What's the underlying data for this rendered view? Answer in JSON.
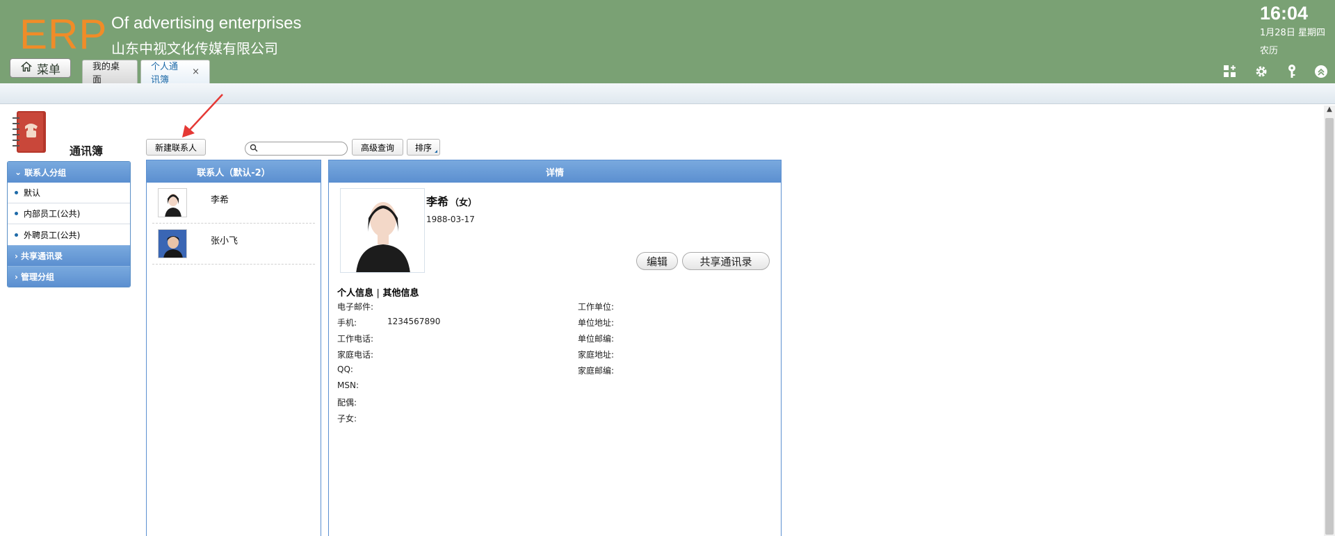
{
  "header": {
    "logo": "ERP",
    "company_en": "Of advertising enterprises",
    "company_cn": "山东中视文化传媒有限公司",
    "clock": "16:04",
    "date": "1月28日 星期四",
    "lunar": "农历",
    "menu_label": "菜单",
    "background_color": "#7aa174",
    "logo_color": "#f08c28"
  },
  "tabs": [
    {
      "label": "我的桌面"
    },
    {
      "label": "个人通讯簿",
      "close": "×"
    }
  ],
  "header_icons": [
    "grid-add-icon",
    "gear-icon",
    "key-icon",
    "collapse-up-icon"
  ],
  "sidebar": {
    "title": "通讯簿",
    "groups": [
      {
        "label": "联系人分组",
        "expanded": true,
        "items": [
          "默认",
          "内部员工(公共)",
          "外聘员工(公共)"
        ]
      },
      {
        "label": "共享通讯录",
        "expanded": false
      },
      {
        "label": "管理分组",
        "expanded": false
      }
    ]
  },
  "toolbar": {
    "new_contact": "新建联系人",
    "search_placeholder": "",
    "advanced_search": "高级查询",
    "sort": "排序"
  },
  "contacts": {
    "header": "联系人（默认-2）",
    "items": [
      {
        "name": "李希"
      },
      {
        "name": "张小飞"
      }
    ]
  },
  "details": {
    "header": "详情",
    "name": "李希",
    "gender": "（女）",
    "birthday": "1988-03-17",
    "edit_button": "编辑",
    "share_button": "共享通讯录",
    "tab_personal": "个人信息",
    "tab_separator": "|",
    "tab_other": "其他信息",
    "fields_left": [
      {
        "label": "电子邮件:",
        "value": ""
      },
      {
        "label": "手机:",
        "value": "1234567890"
      },
      {
        "label": "工作电话:",
        "value": ""
      },
      {
        "label": "家庭电话:",
        "value": ""
      },
      {
        "label": "QQ:",
        "value": ""
      },
      {
        "label": "MSN:",
        "value": ""
      },
      {
        "label": "配偶:",
        "value": ""
      },
      {
        "label": "子女:",
        "value": ""
      }
    ],
    "fields_right": [
      {
        "label": "工作单位:",
        "value": ""
      },
      {
        "label": "单位地址:",
        "value": ""
      },
      {
        "label": "单位邮编:",
        "value": ""
      },
      {
        "label": "家庭地址:",
        "value": ""
      },
      {
        "label": "家庭邮编:",
        "value": ""
      }
    ]
  },
  "colors": {
    "panel_header": "#5b8fd0",
    "annotation_arrow": "#e53935"
  }
}
